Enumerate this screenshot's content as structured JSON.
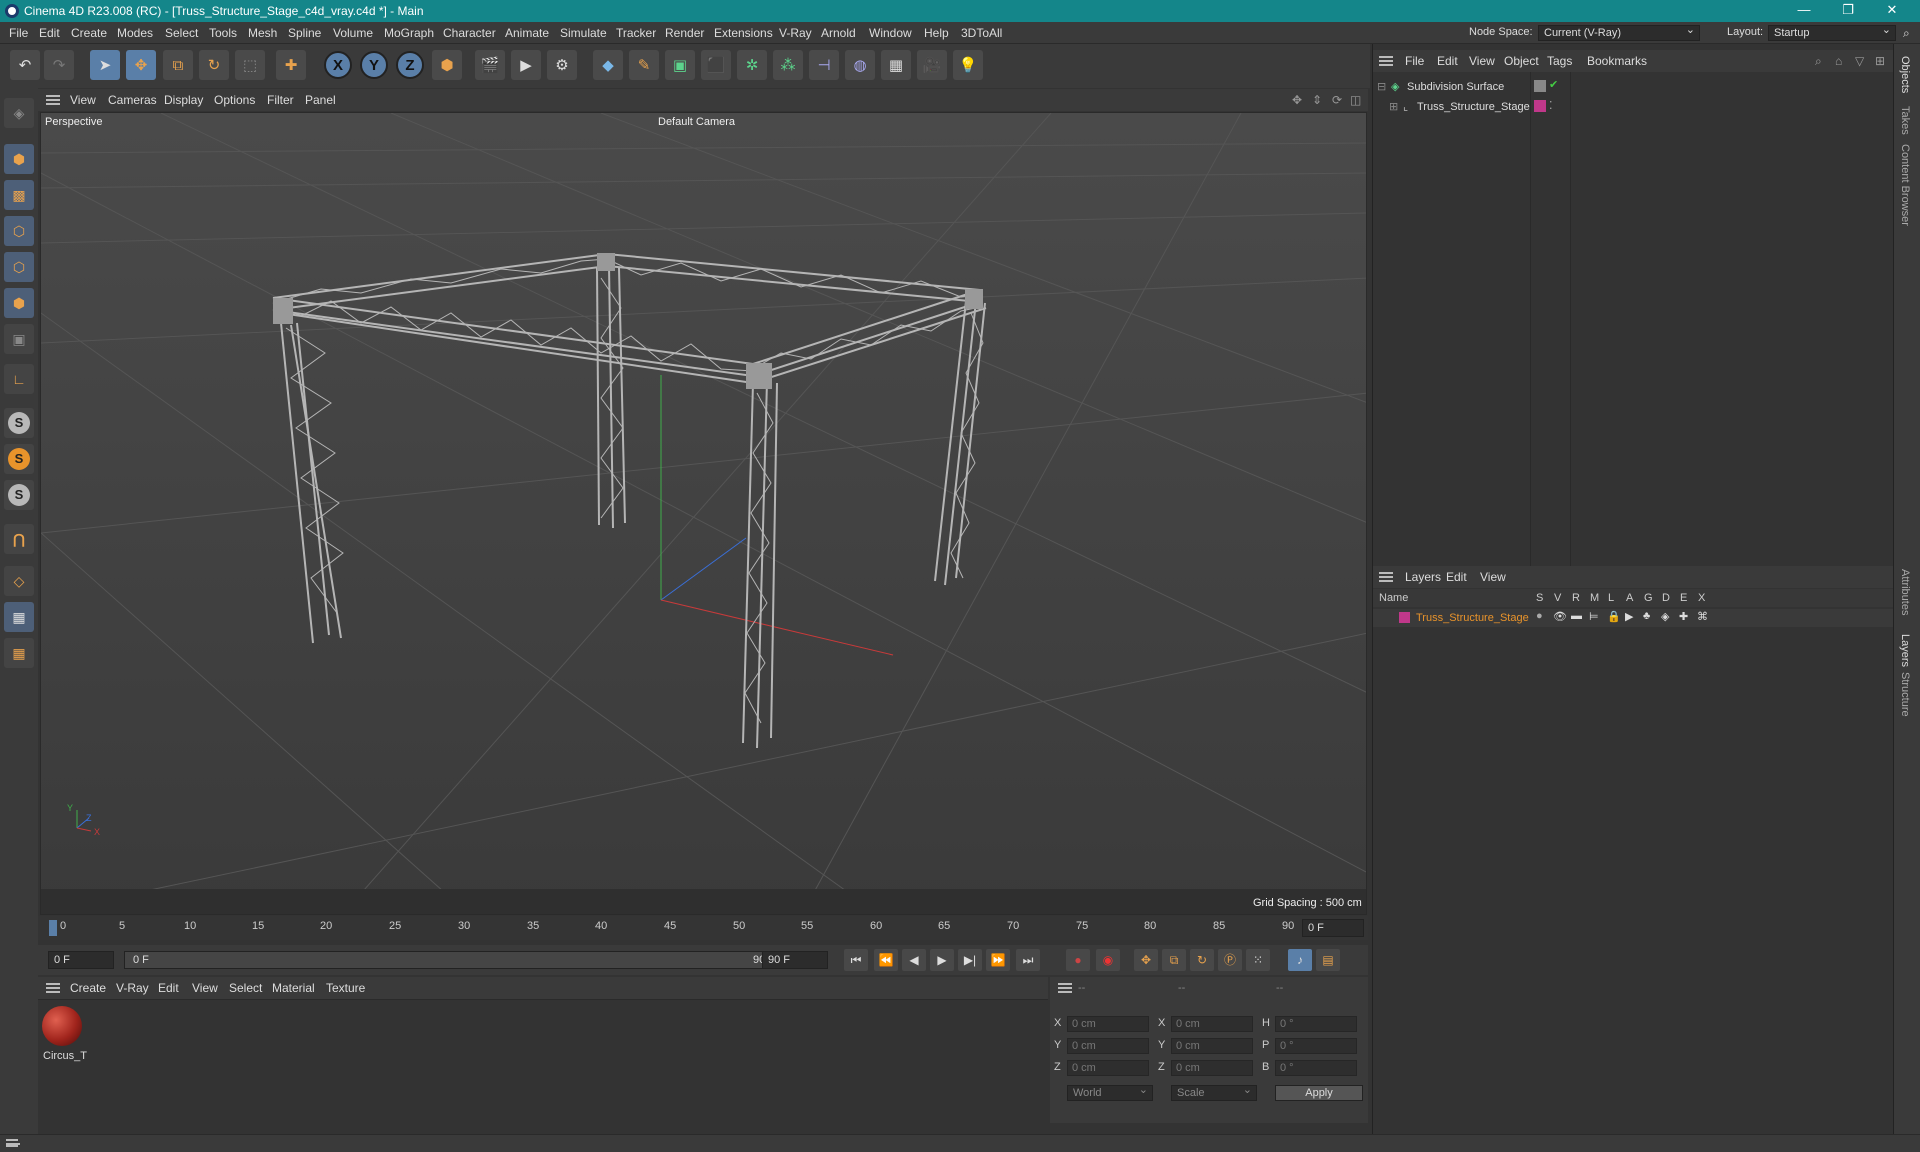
{
  "window": {
    "title": "Cinema 4D R23.008 (RC) - [Truss_Structure_Stage_c4d_vray.c4d *] - Main",
    "controls": [
      "—",
      "❐",
      "✕"
    ]
  },
  "menubar": {
    "items": [
      "File",
      "Edit",
      "Create",
      "Modes",
      "Select",
      "Tools",
      "Mesh",
      "Spline",
      "Volume",
      "MoGraph",
      "Character",
      "Animate",
      "Simulate",
      "Tracker",
      "Render",
      "Extensions",
      "V-Ray",
      "Arnold",
      "Window",
      "Help",
      "3DToAll"
    ],
    "node_space_label": "Node Space:",
    "node_space_value": "Current (V-Ray)",
    "layout_label": "Layout:",
    "layout_value": "Startup"
  },
  "viewport": {
    "menu": [
      "View",
      "Cameras",
      "Display",
      "Options",
      "Filter",
      "Panel"
    ],
    "projection": "Perspective",
    "camera": "Default Camera",
    "grid_spacing": "Grid Spacing : 500 cm",
    "axis_labels": {
      "y": "Y",
      "z": "Z",
      "x": "X"
    }
  },
  "timeline": {
    "ticks": [
      "0",
      "5",
      "10",
      "15",
      "20",
      "25",
      "30",
      "35",
      "40",
      "45",
      "50",
      "55",
      "60",
      "65",
      "70",
      "75",
      "80",
      "85",
      "90"
    ],
    "current_frame": "0 F",
    "start": "0 F",
    "range_start": "0 F",
    "range_end": "90 F",
    "end": "90 F"
  },
  "material_manager": {
    "menu": [
      "Create",
      "V-Ray",
      "Edit",
      "View",
      "Select",
      "Material",
      "Texture"
    ],
    "materials": [
      {
        "name": "Circus_Tr",
        "color": "#a0241c"
      }
    ]
  },
  "coordinates": {
    "headers": [
      "--",
      "--",
      "--"
    ],
    "rows": [
      {
        "axis": "X",
        "pos": "0 cm",
        "axis2": "X",
        "size": "0 cm",
        "rot_label": "H",
        "rot": "0 °"
      },
      {
        "axis": "Y",
        "pos": "0 cm",
        "axis2": "Y",
        "size": "0 cm",
        "rot_label": "P",
        "rot": "0 °"
      },
      {
        "axis": "Z",
        "pos": "0 cm",
        "axis2": "Z",
        "size": "0 cm",
        "rot_label": "B",
        "rot": "0 °"
      }
    ],
    "mode_world": "World",
    "mode_scale": "Scale",
    "apply": "Apply"
  },
  "object_manager": {
    "menu": [
      "File",
      "Edit",
      "View",
      "Object",
      "Tags",
      "Bookmarks"
    ],
    "objects": [
      {
        "name": "Subdivision Surface",
        "icon": "subdivision-icon"
      },
      {
        "name": "Truss_Structure_Stage",
        "icon": "null-object-icon"
      }
    ]
  },
  "layer_manager": {
    "menu": [
      "Layers",
      "Edit",
      "View"
    ],
    "columns": [
      "Name",
      "S",
      "V",
      "R",
      "M",
      "L",
      "A",
      "G",
      "D",
      "E",
      "X"
    ],
    "layers": [
      {
        "name": "Truss_Structure_Stage",
        "color": "#c0388a"
      }
    ]
  },
  "side_tabs": [
    "Objects",
    "Takes",
    "Content Browser",
    "Attributes",
    "Layers",
    "Structure"
  ],
  "colors": {
    "titlebar": "#14868a",
    "accent": "#5a7fa8",
    "layer_name": "#e8932b"
  }
}
